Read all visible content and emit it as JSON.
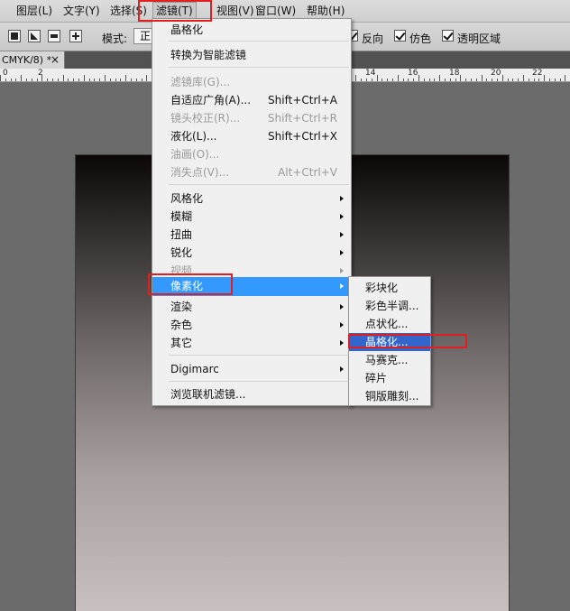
{
  "menubar": {
    "items": [
      {
        "label": "图层(L)"
      },
      {
        "label": "文字(Y)"
      },
      {
        "label": "选择(S)"
      },
      {
        "label": "滤镜(T)"
      },
      {
        "label": "视图(V)"
      },
      {
        "label": "窗口(W)"
      },
      {
        "label": "帮助(H)"
      }
    ]
  },
  "options": {
    "mode_label": "模式:",
    "mode_value": "正",
    "checkboxes": [
      {
        "label": "反向",
        "checked": true
      },
      {
        "label": "仿色",
        "checked": true
      },
      {
        "label": "透明区域",
        "checked": true
      }
    ]
  },
  "document": {
    "tab_title": "CMYK/8) *",
    "close_glyph": "×"
  },
  "ruler": {
    "labels": [
      "0",
      "2",
      "14",
      "16",
      "18",
      "20",
      "22"
    ]
  },
  "filter_menu": {
    "last_filter": "晶格化",
    "convert_smart": "转换为智能滤镜",
    "gallery": {
      "label": "滤镜库(G)...",
      "shortcut": ""
    },
    "adaptive_wide": {
      "label": "自适应广角(A)...",
      "shortcut": "Shift+Ctrl+A"
    },
    "lens_correction": {
      "label": "镜头校正(R)...",
      "shortcut": "Shift+Ctrl+R"
    },
    "liquify": {
      "label": "液化(L)...",
      "shortcut": "Shift+Ctrl+X"
    },
    "oil_paint": {
      "label": "油画(O)...",
      "shortcut": ""
    },
    "vanishing_point": {
      "label": "消失点(V)...",
      "shortcut": "Alt+Ctrl+V"
    },
    "stylize": "风格化",
    "blur": "模糊",
    "distort": "扭曲",
    "sharpen": "锐化",
    "video": "视频",
    "pixelate": "像素化",
    "render": "渲染",
    "noise": "杂色",
    "other": "其它",
    "digimarc": "Digimarc",
    "browse_online": "浏览联机滤镜..."
  },
  "pixelate_submenu": {
    "items": [
      {
        "label": "彩块化"
      },
      {
        "label": "彩色半调..."
      },
      {
        "label": "点状化..."
      },
      {
        "label": "晶格化..."
      },
      {
        "label": "马赛克..."
      },
      {
        "label": "碎片"
      },
      {
        "label": "铜版雕刻..."
      }
    ]
  },
  "colors": {
    "menu_highlight": "#3399ff",
    "submenu_highlight": "#3366cc",
    "annotation": "#e02020"
  }
}
